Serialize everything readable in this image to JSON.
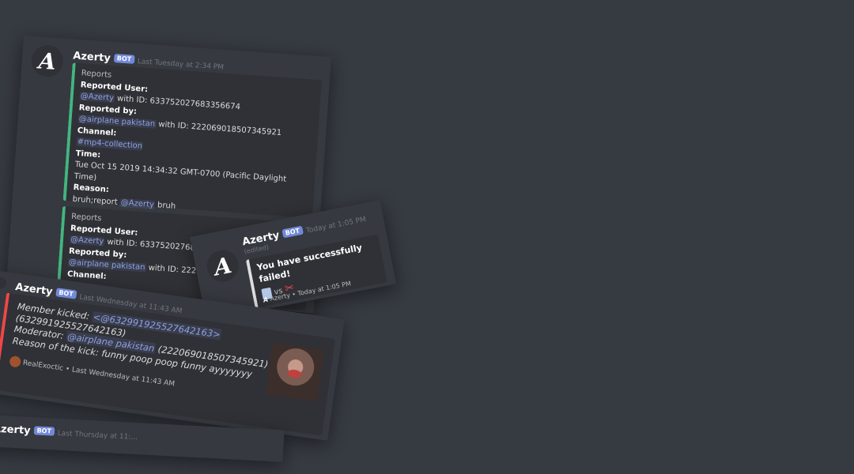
{
  "card1": {
    "bot_name": "Azerty",
    "bot_tag": "BOT",
    "timestamp": "Last Tuesday at 2:34 PM",
    "avatar_letter": "A",
    "embed": {
      "title": "Reports",
      "reported_user_label": "Reported User:",
      "reported_user_mention": "@Azerty",
      "reported_user_id": "with ID: 633752027683356674",
      "reported_by_label": "Reported by:",
      "reported_by_mention": "@airplane pakistan",
      "reported_by_id": "with ID: 222069018507345921",
      "channel_label": "Channel:",
      "channel_value": "#mp4-collection",
      "time_label": "Time:",
      "time_value": "Tue Oct 15 2019 14:34:32 GMT-0700 (Pacific Daylight Time)",
      "reason_label": "Reason:",
      "reason_prefix": "bruh;report",
      "reason_mention": "@Azerty",
      "reason_suffix": "bruh"
    },
    "embed2": {
      "title": "Reports",
      "reported_user_label": "Reported User:",
      "reported_user_mention": "@Azerty",
      "reported_user_id": "with ID: 633752027683356674",
      "reported_by_label": "Reported by:",
      "reported_by_mention": "@airplane pakistan",
      "reported_by_id": "with ID: 222069018507345921",
      "channel_label": "Channel:"
    }
  },
  "card2": {
    "bot_name": "Azerty",
    "bot_tag": "BOT",
    "timestamp": "Today at 1:05 PM",
    "avatar_letter": "A",
    "edited": "(edited)",
    "embed_title": "You have successfully failed!",
    "vs_text": "vs",
    "footer_name": "Azerty",
    "footer_time": "Today at 1:05 PM",
    "footer_icon_letter": "A"
  },
  "card3": {
    "bot_name": "Azerty",
    "bot_tag": "BOT",
    "timestamp": "Last Wednesday at 11:43 AM",
    "line1_label": "Member kicked:",
    "line1_mention": "<@632991925527642163>",
    "line2": "(632991925527642163)",
    "line3_label": "Moderator:",
    "line3_mention": "@airplane pakistan",
    "line3_id": "(222069018507345921)",
    "line4_label": "Reason of the kick:",
    "line4_value": "funny poop poop funny ayyyyyyy",
    "footer_name": "RealExoctic",
    "footer_time": "Last Wednesday at 11:43 AM"
  },
  "card4": {
    "bot_name": "Azerty",
    "bot_tag": "BOT",
    "timestamp": "Last Thursday at 11:..."
  },
  "colors": {
    "background": "#363a41",
    "embed_green": "#43b581",
    "embed_white": "#dcddde",
    "embed_red": "#f04747",
    "mention": "#8ea1e1",
    "bot_tag": "#7289da"
  }
}
